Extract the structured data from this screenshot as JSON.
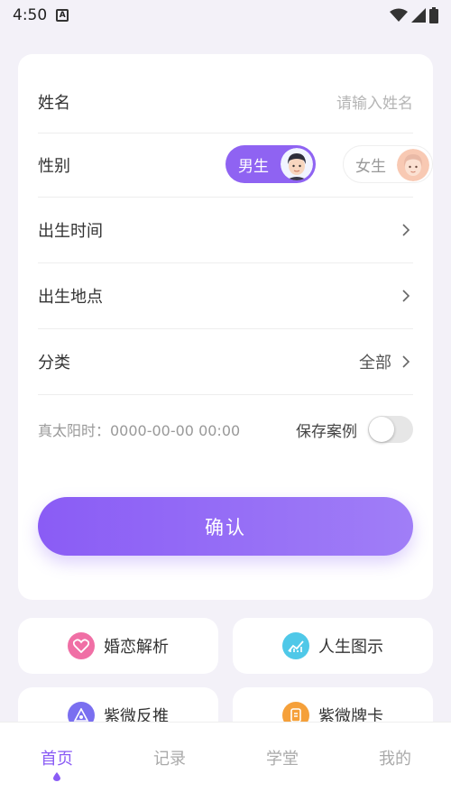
{
  "status_bar": {
    "time": "4:50",
    "notification_icon": "app-a-icon",
    "icons": [
      "wifi-icon",
      "signal-icon",
      "battery-icon"
    ]
  },
  "form": {
    "name": {
      "label": "姓名",
      "placeholder": "请输入姓名"
    },
    "gender": {
      "label": "性别",
      "male": "男生",
      "female": "女生",
      "selected": "male"
    },
    "birth_time": {
      "label": "出生时间"
    },
    "birth_place": {
      "label": "出生地点"
    },
    "category": {
      "label": "分类",
      "value": "全部"
    },
    "solar_time": {
      "label": "真太阳时：0000-00-00 00:00"
    },
    "save_case": {
      "label": "保存案例",
      "on": false
    },
    "confirm": "确认"
  },
  "features": [
    {
      "label": "婚恋解析",
      "icon": "heart-icon",
      "color": "#f06fa5"
    },
    {
      "label": "人生图示",
      "icon": "chart-icon",
      "color": "#4fc8e8"
    },
    {
      "label": "紫微反推",
      "icon": "star-chart-icon",
      "color": "#7a6ff0"
    },
    {
      "label": "紫微牌卡",
      "icon": "card-icon",
      "color": "#f5a03a"
    }
  ],
  "tabbar": {
    "items": [
      {
        "label": "首页",
        "active": true
      },
      {
        "label": "记录",
        "active": false
      },
      {
        "label": "学堂",
        "active": false
      },
      {
        "label": "我的",
        "active": false
      }
    ]
  },
  "colors": {
    "accent": "#8a5cf5",
    "background": "#f3f1f8"
  }
}
